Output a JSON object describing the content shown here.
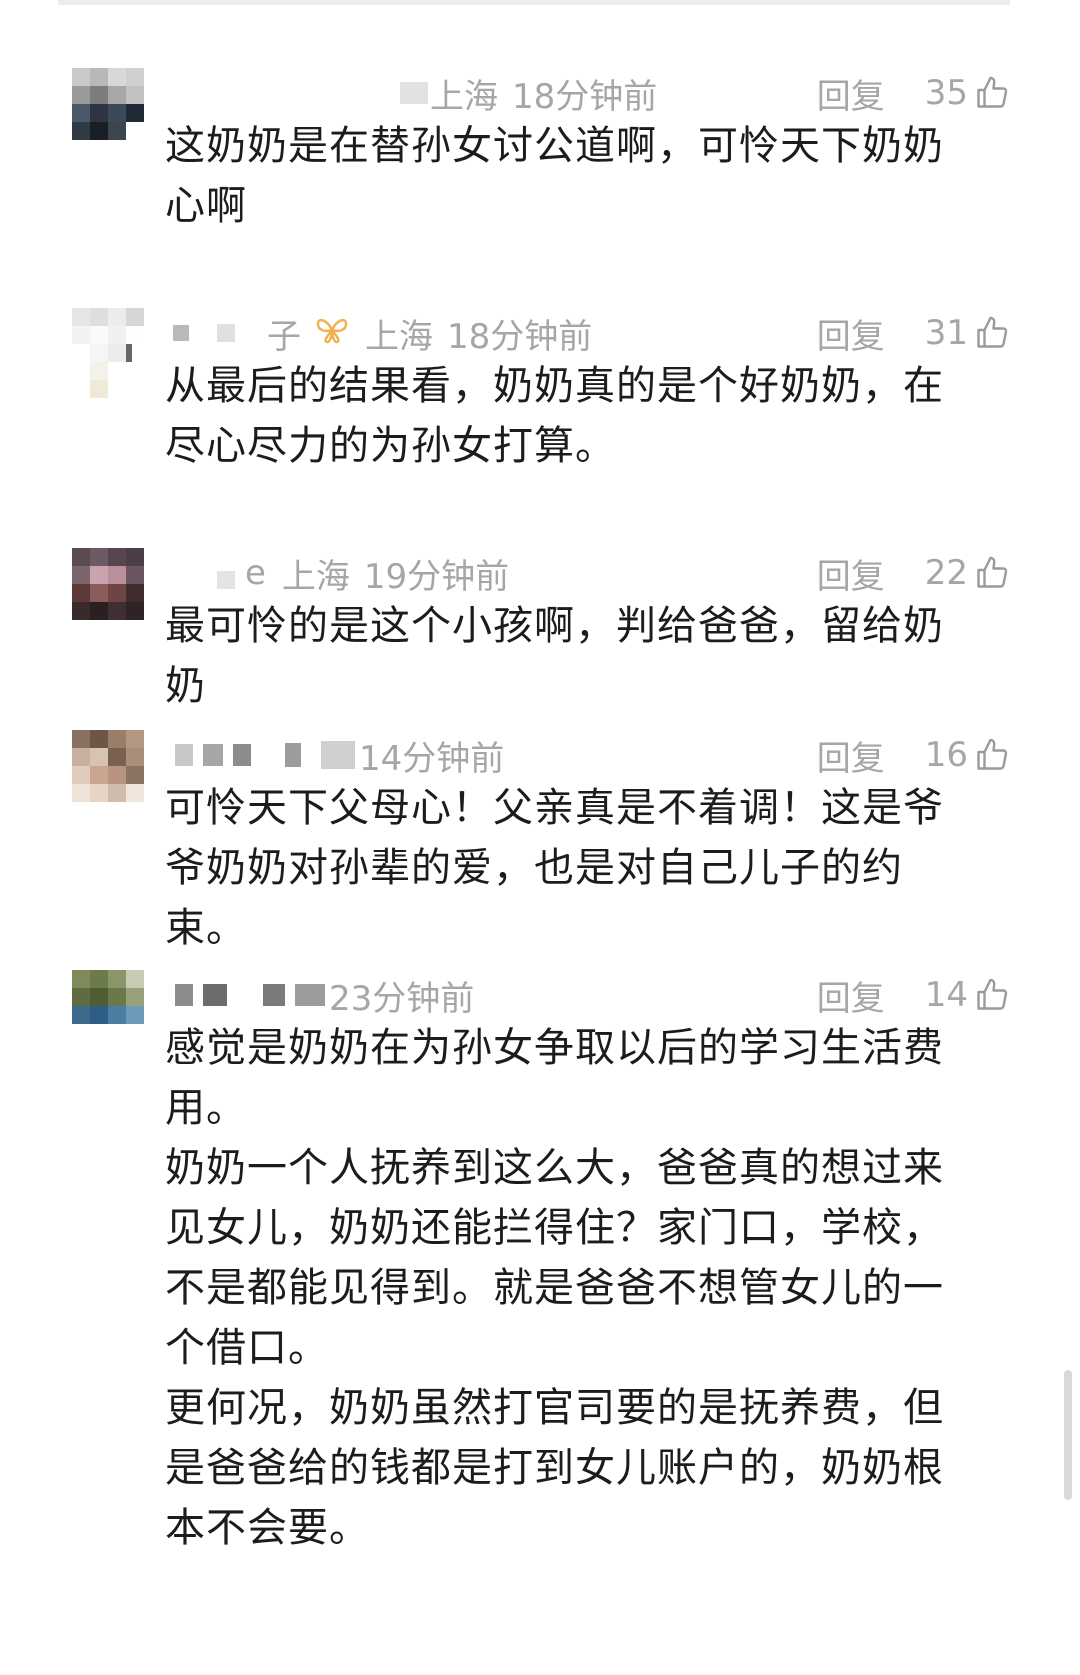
{
  "reply_label": "回复",
  "comments": [
    {
      "name": "",
      "location": "上海",
      "time": "18分钟前",
      "likes": "35",
      "text": [
        "这奶奶是在替孙女讨公道啊，可怜天下奶奶心啊"
      ]
    },
    {
      "name": "子",
      "location": "上海",
      "time": "18分钟前",
      "likes": "31",
      "badge": "butterfly-icon",
      "text": [
        "从最后的结果看，奶奶真的是个好奶奶，在尽心尽力的为孙女打算。"
      ]
    },
    {
      "name": "e",
      "location": "上海",
      "time": "19分钟前",
      "likes": "22",
      "text": [
        "最可怜的是这个小孩啊，判给爸爸，留给奶奶"
      ]
    },
    {
      "name": "",
      "location": "",
      "time": "14分钟前",
      "likes": "16",
      "text": [
        "可怜天下父母心！父亲真是不着调！这是爷爷奶奶对孙辈的爱，也是对自己儿子的约束。"
      ]
    },
    {
      "name": "",
      "location": "",
      "time": "23分钟前",
      "likes": "14",
      "text": [
        "感觉是奶奶在为孙女争取以后的学习生活费用。",
        "奶奶一个人抚养到这么大，爸爸真的想过来见女儿，奶奶还能拦得住？家门口，学校，不是都能见得到。就是爸爸不想管女儿的一个借口。",
        "更何况，奶奶虽然打官司要的是抚养费，但是爸爸给的钱都是打到女儿账户的，奶奶根本不会要。"
      ]
    }
  ],
  "colors": {
    "meta_text": "#a6a6a6",
    "content_text": "#1c1c1c",
    "badge": "#f2b04c"
  }
}
